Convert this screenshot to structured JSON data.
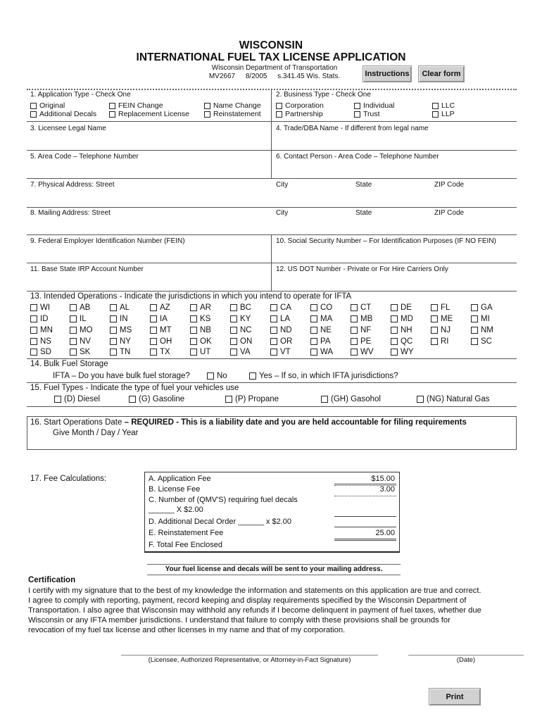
{
  "header": {
    "state": "WISCONSIN",
    "title": "INTERNATIONAL FUEL TAX LICENSE APPLICATION",
    "department": "Wisconsin Department of Transportation",
    "form_number": "MV2667",
    "form_date": "8/2005",
    "statute": "s.341.45 Wis. Stats."
  },
  "buttons": {
    "instructions": "Instructions",
    "clear_form": "Clear form",
    "print": "Print"
  },
  "section1": {
    "label": "1.  Application Type - Check One",
    "options": [
      "Original",
      "FEIN Change",
      "Name Change",
      "Additional Decals",
      "Replacement License",
      "Reinstatement"
    ]
  },
  "section2": {
    "label": "2.  Business Type - Check One",
    "options": [
      "Corporation",
      "Individual",
      "LLC",
      "Partnership",
      "Trust",
      "LLP"
    ]
  },
  "fields": {
    "f3": "3.  Licensee Legal Name",
    "f4": "4.  Trade/DBA Name - If different from legal name",
    "f5": "5.  Area Code – Telephone Number",
    "f6": "6.  Contact Person - Area Code – Telephone Number",
    "f7": "7.  Physical Address:  Street",
    "f8": "8.  Mailing Address:  Street",
    "city": "City",
    "state": "State",
    "zip": "ZIP Code",
    "f9": "9.  Federal Employer Identification Number (FEIN)",
    "f10": "10.  Social Security Number – For Identification Purposes (IF NO FEIN)",
    "f11": "11.  Base State IRP Account Number",
    "f12": "12.  US DOT Number - Private or For Hire Carriers Only"
  },
  "section13": {
    "label": "13.  Intended Operations - Indicate the jurisdictions in which you intend to operate for IFTA",
    "rows": [
      [
        "WI",
        "AB",
        "AL",
        "AZ",
        "AR",
        "BC",
        "CA",
        "CO",
        "CT",
        "DE",
        "FL",
        "GA"
      ],
      [
        "ID",
        "IL",
        "IN",
        "IA",
        "KS",
        "KY",
        "LA",
        "MA",
        "MB",
        "MD",
        "ME",
        "MI"
      ],
      [
        "MN",
        "MO",
        "MS",
        "MT",
        "NB",
        "NC",
        "ND",
        "NE",
        "NF",
        "NH",
        "NJ",
        "NM"
      ],
      [
        "NS",
        "NV",
        "NY",
        "OH",
        "OK",
        "ON",
        "OR",
        "PA",
        "PE",
        "QC",
        "RI",
        "SC"
      ],
      [
        "SD",
        "SK",
        "TN",
        "TX",
        "UT",
        "VA",
        "VT",
        "WA",
        "WV",
        "WY"
      ]
    ]
  },
  "section14": {
    "label": "14.  Bulk Fuel Storage",
    "question": "IFTA – Do you have bulk fuel storage?",
    "no": "No",
    "yes": "Yes – If so, in which IFTA jurisdictions?"
  },
  "section15": {
    "label": "15.  Fuel Types - Indicate the type of fuel your vehicles use",
    "options": [
      "(D) Diesel",
      "(G) Gasoline",
      "(P) Propane",
      "(GH) Gasohol",
      "(NG) Natural Gas"
    ]
  },
  "section16": {
    "label": "16.  Start Operations Date",
    "required": "– REQUIRED - This is a liability date and you are held accountable for filing requirements",
    "hint": "Give Month / Day / Year"
  },
  "section17": {
    "label": "17.  Fee Calculations:",
    "rows": {
      "a": "A. Application Fee",
      "a_val": "$15.00",
      "b": "B. License Fee",
      "b_val": "3.00",
      "c": "C. Number of  (QMV'S) requiring fuel decals",
      "c2": "______ X $2.00",
      "d": "D. Additional Decal Order ______ x $2.00",
      "e": "E. Reinstatement Fee",
      "e_val": "25.00",
      "f": "F. Total Fee Enclosed"
    }
  },
  "notice": "Your fuel license and decals will be sent to your mailing address.",
  "certification": {
    "title": "Certification",
    "lines": [
      "I certify with my signature that to the best of my knowledge the information and statements on this application are true and correct.",
      "I agree to comply with reporting, payment, record keeping and display requirements specified by the Wisconsin Department of",
      "Transportation.  I also agree that Wisconsin may withhold any refunds if I become delinquent in payment of fuel taxes, whether due",
      "Wisconsin or any IFTA member jurisdictions.  I understand that failure to comply with these provisions shall be grounds for",
      "revocation of my fuel tax license and other licenses in my name and that of my corporation."
    ]
  },
  "signature": {
    "signature_label": "(Licensee, Authorized Representative, or Attorney-in-Fact Signature)",
    "date_label": "(Date)"
  }
}
